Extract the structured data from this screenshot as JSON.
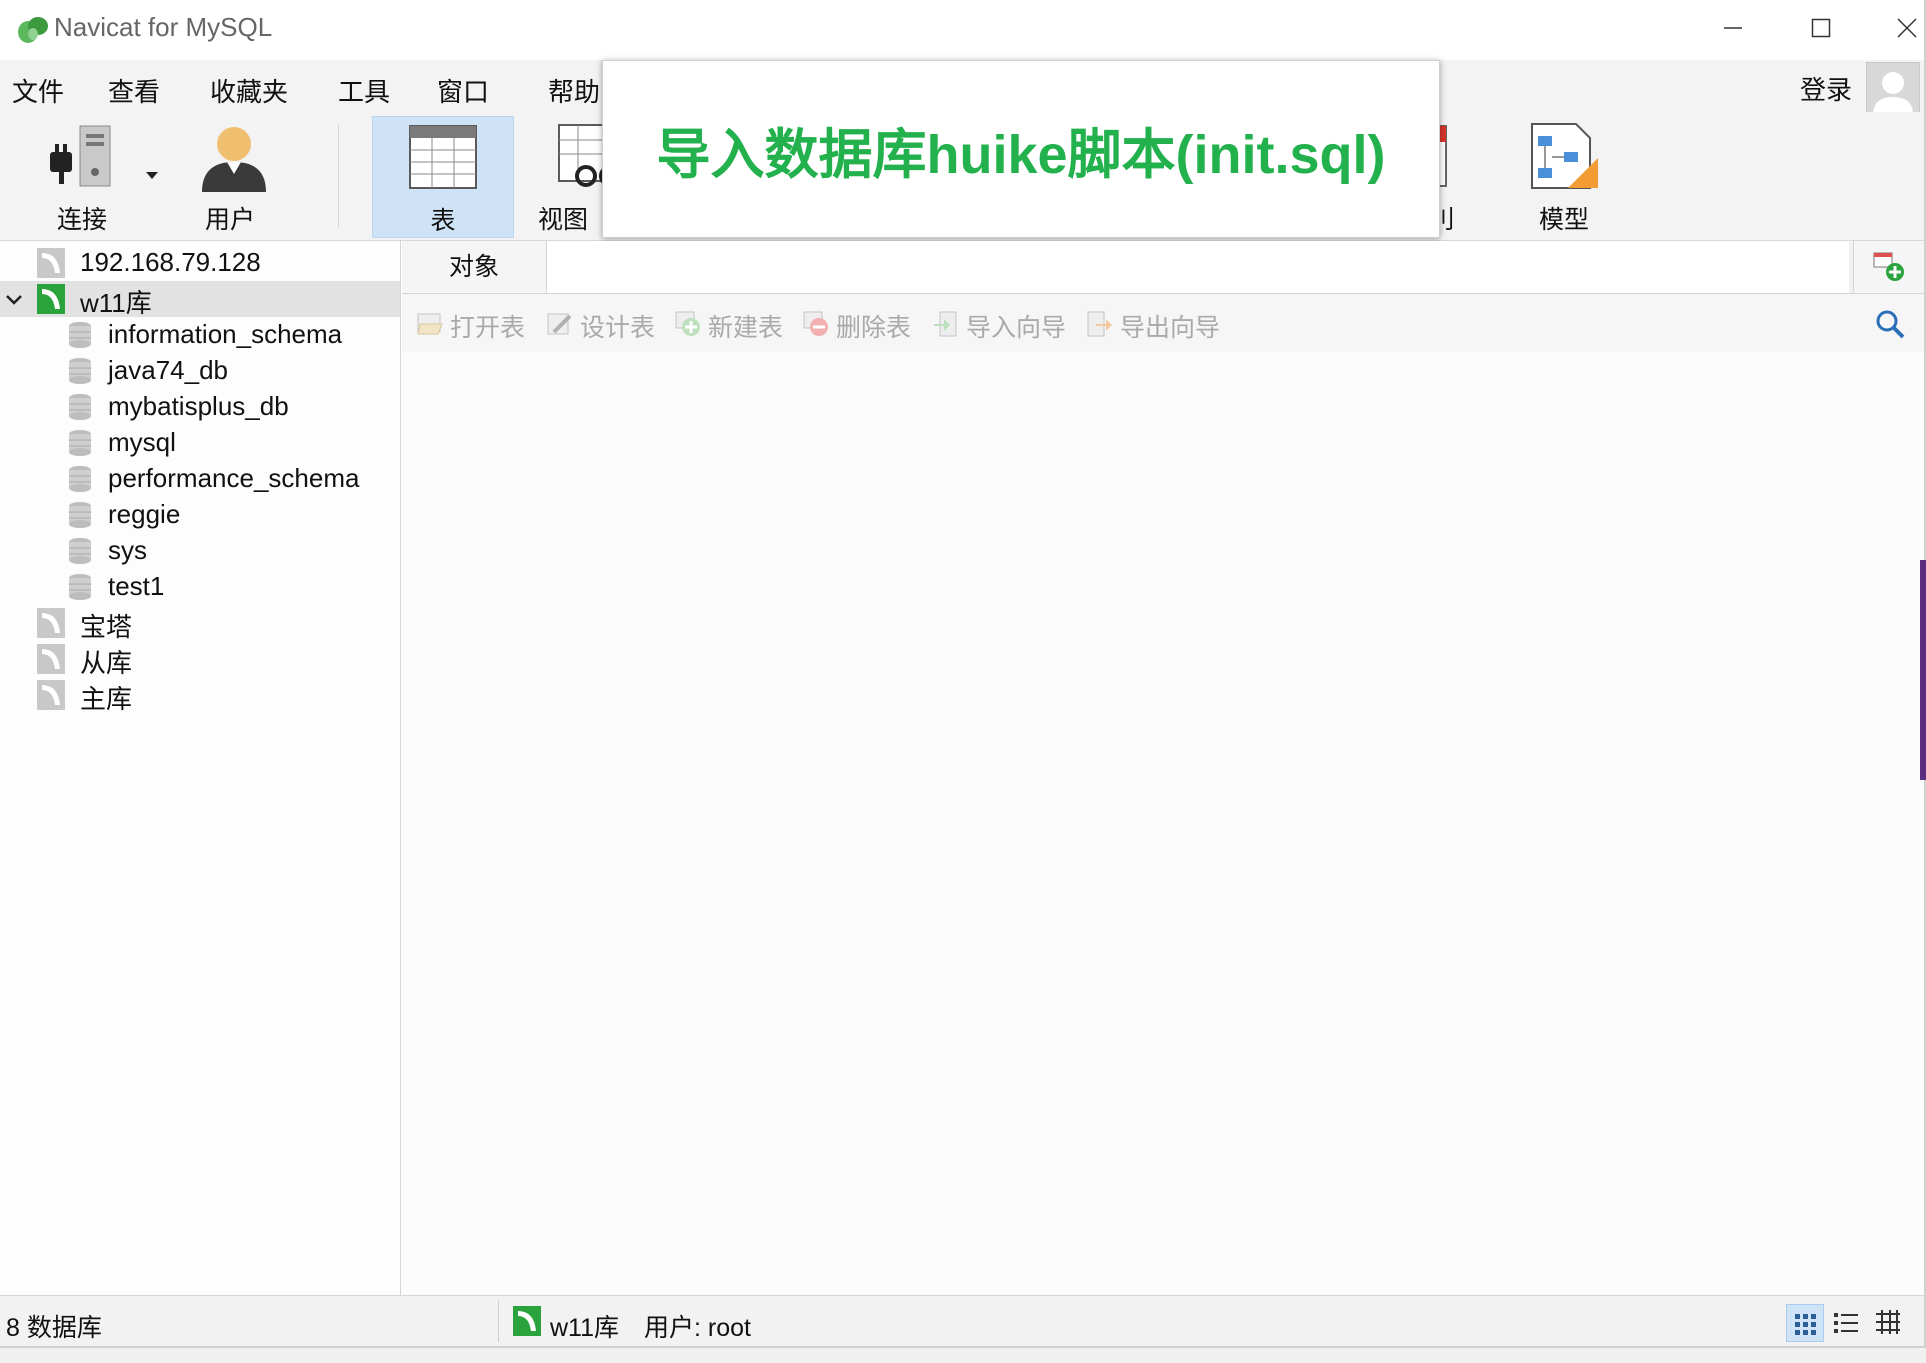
{
  "window": {
    "title": "Navicat for MySQL"
  },
  "menu": [
    "文件",
    "查看",
    "收藏夹",
    "工具",
    "窗口",
    "帮助"
  ],
  "login": "登录",
  "toolbar": {
    "connect": "连接",
    "user": "用户",
    "table": "表",
    "view": "视图",
    "partial": "刂",
    "model": "模型"
  },
  "overlay_caption": "导入数据库huike脚本(init.sql)",
  "tree": {
    "connections": [
      {
        "label": "192.168.79.128",
        "color": "#b9b9b9"
      },
      {
        "label": "w11库",
        "color": "#2aa33c"
      },
      {
        "label": "宝塔",
        "color": "#b9b9b9"
      },
      {
        "label": "从库",
        "color": "#b9b9b9"
      },
      {
        "label": "主库",
        "color": "#b9b9b9"
      }
    ],
    "databases": [
      "information_schema",
      "java74_db",
      "mybatisplus_db",
      "mysql",
      "performance_schema",
      "reggie",
      "sys",
      "test1"
    ]
  },
  "tabs": {
    "objects": "对象"
  },
  "actions": [
    "打开表",
    "设计表",
    "新建表",
    "删除表",
    "导入向导",
    "导出向导"
  ],
  "status": {
    "db_count": "8 数据库",
    "connection": "w11库",
    "user": "用户: root"
  },
  "colors": {
    "accent_green": "#22b14c",
    "selection_blue": "#cfe3f7"
  }
}
